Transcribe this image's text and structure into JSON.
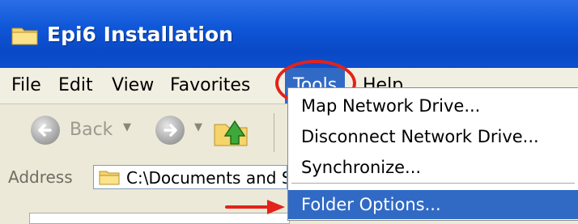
{
  "window": {
    "title": "Epi6 Installation"
  },
  "menubar": {
    "file": "File",
    "edit": "Edit",
    "view": "View",
    "favorites": "Favorites",
    "tools": "Tools",
    "help": "Help"
  },
  "toolbar": {
    "back_label": "Back"
  },
  "address": {
    "label": "Address",
    "value": "C:\\Documents and S"
  },
  "tools_menu": {
    "items": [
      {
        "label": "Map Network Drive..."
      },
      {
        "label": "Disconnect Network Drive..."
      },
      {
        "label": "Synchronize..."
      },
      {
        "label": "Folder Options..."
      }
    ]
  },
  "annotation_color": "#e2231a",
  "highlight_color": "#316ac5"
}
